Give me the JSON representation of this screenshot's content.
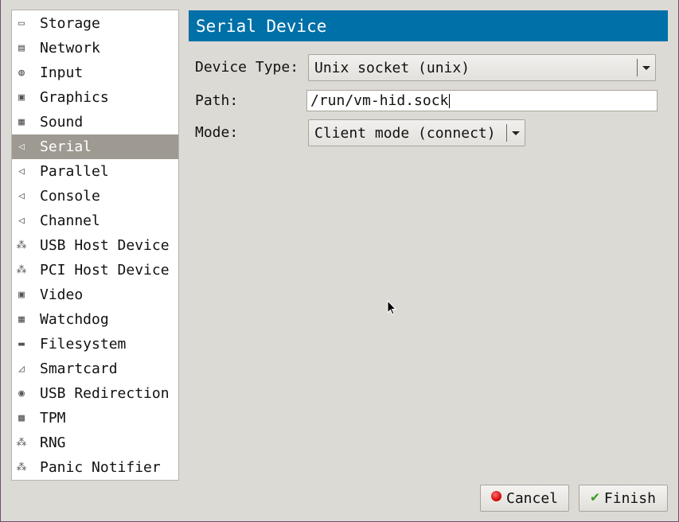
{
  "sidebar": {
    "items": [
      {
        "label": "Storage",
        "icon": "storage-icon",
        "glyph": "▭"
      },
      {
        "label": "Network",
        "icon": "network-icon",
        "glyph": "▤"
      },
      {
        "label": "Input",
        "icon": "mouse-icon",
        "glyph": "◍"
      },
      {
        "label": "Graphics",
        "icon": "monitor-icon",
        "glyph": "▣"
      },
      {
        "label": "Sound",
        "icon": "sound-card-icon",
        "glyph": "▦"
      },
      {
        "label": "Serial",
        "icon": "serial-port-icon",
        "glyph": "◁",
        "selected": true
      },
      {
        "label": "Parallel",
        "icon": "parallel-port-icon",
        "glyph": "◁"
      },
      {
        "label": "Console",
        "icon": "console-port-icon",
        "glyph": "◁"
      },
      {
        "label": "Channel",
        "icon": "channel-port-icon",
        "glyph": "◁"
      },
      {
        "label": "USB Host Device",
        "icon": "usb-device-icon",
        "glyph": "⁂"
      },
      {
        "label": "PCI Host Device",
        "icon": "pci-device-icon",
        "glyph": "⁂"
      },
      {
        "label": "Video",
        "icon": "video-monitor-icon",
        "glyph": "▣"
      },
      {
        "label": "Watchdog",
        "icon": "watchdog-icon",
        "glyph": "▦"
      },
      {
        "label": "Filesystem",
        "icon": "folder-icon",
        "glyph": "▬"
      },
      {
        "label": "Smartcard",
        "icon": "smartcard-icon",
        "glyph": "◿"
      },
      {
        "label": "USB Redirection",
        "icon": "usb-redirection-icon",
        "glyph": "◉"
      },
      {
        "label": "TPM",
        "icon": "chip-icon",
        "glyph": "▩"
      },
      {
        "label": "RNG",
        "icon": "rng-icon",
        "glyph": "⁂"
      },
      {
        "label": "Panic Notifier",
        "icon": "panic-notifier-icon",
        "glyph": "⁂"
      }
    ]
  },
  "header": {
    "title": "Serial Device"
  },
  "form": {
    "device_type_label": "Device Type:",
    "device_type_value": "Unix socket (unix)",
    "path_label": "Path:",
    "path_value": "/run/vm-hid.sock",
    "mode_label": "Mode:",
    "mode_value": "Client mode (connect)"
  },
  "buttons": {
    "cancel": "Cancel",
    "finish": "Finish"
  },
  "colors": {
    "header_bg": "#0070a8",
    "selected_bg": "#9e9a91",
    "window_bg": "#dcdad5"
  }
}
